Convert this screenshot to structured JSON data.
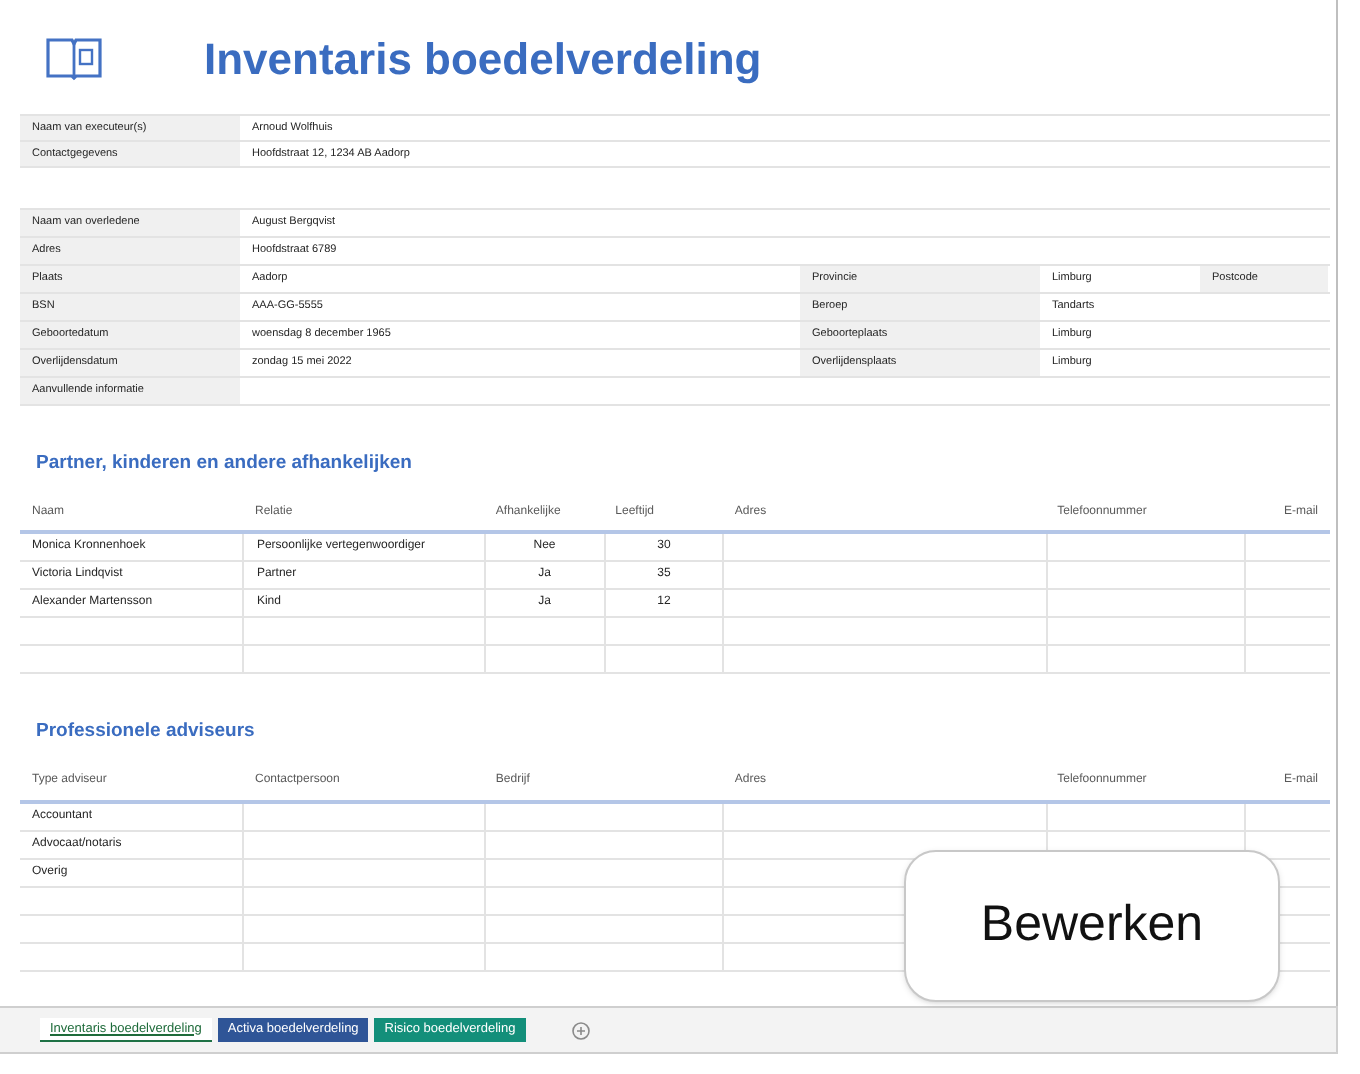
{
  "title": "Inventaris boedelverdeling",
  "executor": [
    {
      "label": "Naam van executeur(s)",
      "value": "Arnoud Wolfhuis"
    },
    {
      "label": "Contactgegevens",
      "value": "Hoofdstraat 12, 1234 AB Aadorp"
    }
  ],
  "deceased": {
    "rows": [
      {
        "label": "Naam van overledene",
        "value": "August Bergqvist"
      },
      {
        "label": "Adres",
        "value": "Hoofdstraat 6789"
      },
      {
        "label": "Plaats",
        "value": "Aadorp"
      },
      {
        "label": "BSN",
        "value": "AAA-GG-5555"
      },
      {
        "label": "Geboortedatum",
        "value": "woensdag 8 december 1965"
      },
      {
        "label": "Overlijdensdatum",
        "value": "zondag 15 mei 2022"
      },
      {
        "label": "Aanvullende informatie"
      }
    ],
    "side_rows": [
      {
        "label": "Provincie",
        "value": "Limburg",
        "extra_label": "Postcode"
      },
      {
        "label": "Beroep",
        "value": "Tandarts"
      },
      {
        "label": "Geboorteplaats",
        "value": "Limburg"
      },
      {
        "label": "Overlijdensplaats",
        "value": "Limburg"
      }
    ]
  },
  "dependents": {
    "title": "Partner, kinderen en andere afhankelijken",
    "columns": [
      "Naam",
      "Relatie",
      "Afhankelijke",
      "Leeftijd",
      "Adres",
      "Telefoonnummer",
      "E-mail"
    ],
    "rows": [
      [
        "Monica Kronnenhoek",
        "Persoonlijke vertegenwoordiger",
        "Nee",
        "30"
      ],
      [
        "Victoria Lindqvist",
        "Partner",
        "Ja",
        "35"
      ],
      [
        "Alexander Martensson",
        "Kind",
        "Ja",
        "12"
      ]
    ]
  },
  "advisors": {
    "title": "Professionele adviseurs",
    "columns": [
      "Type adviseur",
      "Contactpersoon",
      "Bedrijf",
      "Adres",
      "Telefoonnummer",
      "E-mail"
    ],
    "rows": [
      [
        "Accountant"
      ],
      [
        "Advocaat/notaris"
      ],
      [
        "Overig"
      ]
    ]
  },
  "edit_button": "Bewerken",
  "sheet_tabs": [
    {
      "label": "Inventaris boedelverdeling",
      "selected": true,
      "color": "#ffffff"
    },
    {
      "label": "Activa boedelverdeling",
      "selected": false,
      "color": "#2f5597"
    },
    {
      "label": "Risico boedelverdeling",
      "selected": false,
      "color": "#138f7a"
    }
  ]
}
